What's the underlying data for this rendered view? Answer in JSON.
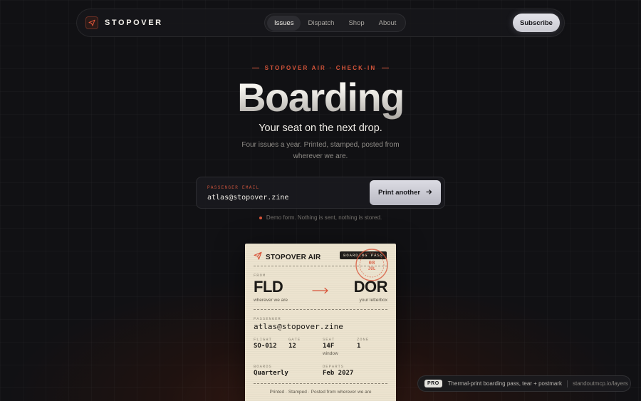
{
  "nav": {
    "brand": "STOPOVER",
    "links": [
      "Issues",
      "Dispatch",
      "Shop",
      "About"
    ],
    "active_link": "Issues",
    "subscribe_label": "Subscribe"
  },
  "hero": {
    "eyebrow": "STOPOVER AIR · CHECK-IN",
    "title": "Boarding",
    "subtitle": "Your seat on the next drop.",
    "blurb": "Four issues a year. Printed, stamped, posted from wherever we are."
  },
  "form": {
    "label": "PASSENGER EMAIL",
    "value": "atlas@stopover.zine",
    "button_label": "Print another",
    "note": "Demo form. Nothing is sent, nothing is stored."
  },
  "ticket": {
    "airline": "STOPOVER AIR",
    "badge": "BOARDING PASS",
    "stamp_date": "08",
    "stamp_month": "JUL",
    "from_label": "FROM",
    "from_code": "FLD",
    "from_sub": "wherever we are",
    "to_code": "DOR",
    "to_sub": "your letterbox",
    "passenger_label": "PASSENGER",
    "passenger": "atlas@stopover.zine",
    "flight_label": "FLIGHT",
    "flight": "SO-012",
    "gate_label": "GATE",
    "gate": "12",
    "seat_label": "SEAT",
    "seat": "14F",
    "seat_sub": "window",
    "zone_label": "ZONE",
    "zone": "1",
    "boards_label": "BOARDS",
    "boards": "Quarterly",
    "departs_label": "DEPARTS",
    "departs": "Feb 2027",
    "footer": "Printed · Stamped · Posted from wherever we are"
  },
  "pro": {
    "badge": "PRO",
    "text": "Thermal-print boarding pass, tear + postmark",
    "link": "standoutmcp.io/layers"
  },
  "colors": {
    "accent": "#d8553a",
    "ticket_paper": "#ece3cf",
    "background": "#111114"
  }
}
